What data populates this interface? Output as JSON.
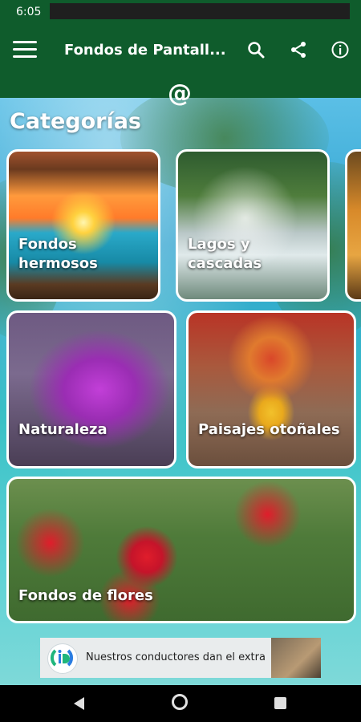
{
  "status_bar": {
    "time": "6:05"
  },
  "app_bar": {
    "title": "Fondos de Pantall...",
    "icons": [
      "menu-icon",
      "search-icon",
      "share-icon",
      "info-icon"
    ],
    "color": "#0f5c2c",
    "below_icon": "@"
  },
  "main": {
    "section_title": "Categorías",
    "categories": [
      {
        "label": "Fondos hermosos"
      },
      {
        "label": "Lagos y cascadas"
      },
      {
        "label": "Naturaleza"
      },
      {
        "label": "Paisajes otoñales"
      },
      {
        "label": "Fondos de flores"
      }
    ]
  },
  "ad": {
    "text": "Nuestros conductores dan el extra"
  },
  "nav_bar": {
    "icons": [
      "back-icon",
      "home-icon",
      "recents-icon"
    ]
  }
}
